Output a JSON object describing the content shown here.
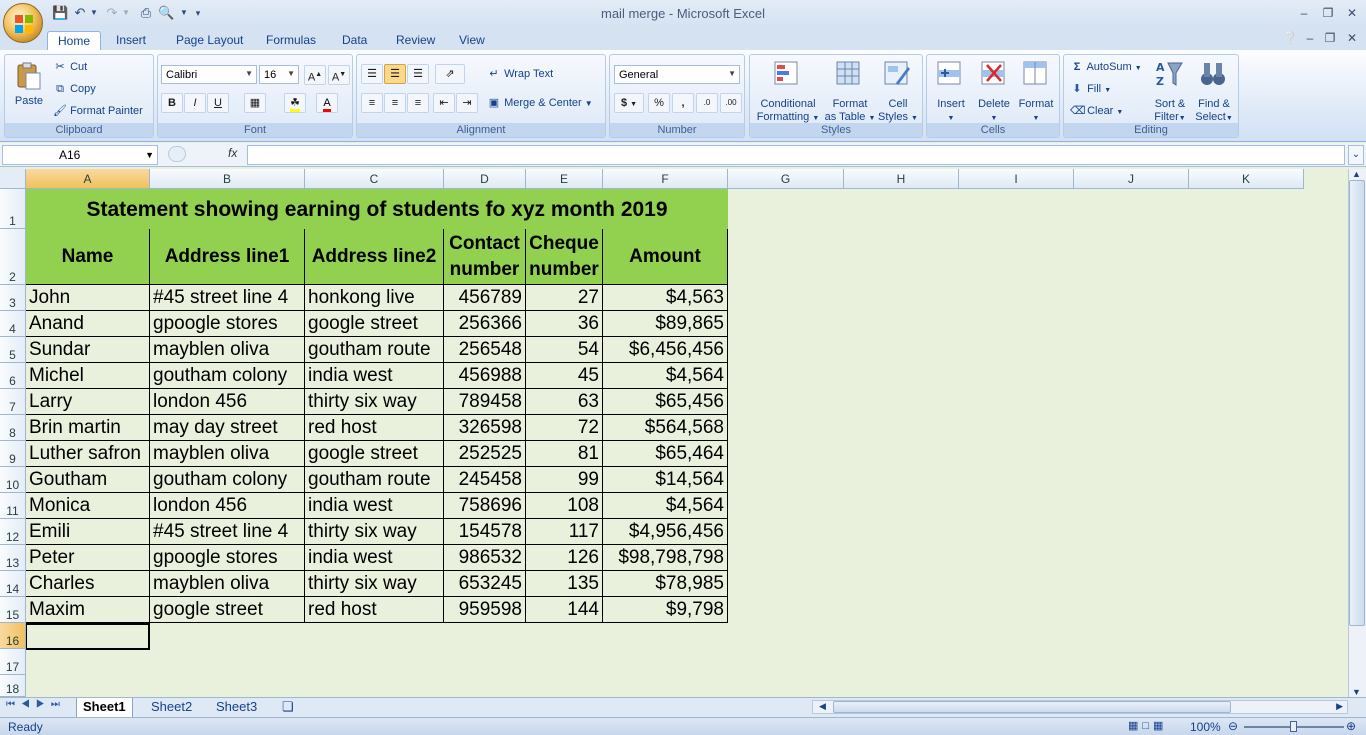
{
  "app": {
    "title": "mail merge - Microsoft Excel"
  },
  "tabs": [
    "Home",
    "Insert",
    "Page Layout",
    "Formulas",
    "Data",
    "Review",
    "View"
  ],
  "ribbon": {
    "clipboard": {
      "paste": "Paste",
      "cut": "Cut",
      "copy": "Copy",
      "format_painter": "Format Painter",
      "label": "Clipboard"
    },
    "font": {
      "name": "Calibri",
      "size": "16",
      "label": "Font"
    },
    "alignment": {
      "wrap": "Wrap Text",
      "merge": "Merge & Center",
      "label": "Alignment"
    },
    "number": {
      "format": "General",
      "label": "Number"
    },
    "styles": {
      "conditional_1": "Conditional",
      "conditional_2": "Formatting",
      "format_table_1": "Format",
      "format_table_2": "as Table",
      "cell_styles_1": "Cell",
      "cell_styles_2": "Styles",
      "label": "Styles"
    },
    "cells": {
      "insert": "Insert",
      "delete": "Delete",
      "format": "Format",
      "label": "Cells"
    },
    "editing": {
      "autosum": "AutoSum",
      "fill": "Fill",
      "clear": "Clear",
      "sort_1": "Sort &",
      "sort_2": "Filter",
      "find_1": "Find &",
      "find_2": "Select",
      "label": "Editing"
    }
  },
  "formula_bar": {
    "name_box": "A16",
    "fx": "fx",
    "value": ""
  },
  "columns": [
    "A",
    "B",
    "C",
    "D",
    "E",
    "F",
    "G",
    "H",
    "I",
    "J",
    "K"
  ],
  "rows": [
    "1",
    "2",
    "3",
    "4",
    "5",
    "6",
    "7",
    "8",
    "9",
    "10",
    "11",
    "12",
    "13",
    "14",
    "15",
    "16",
    "17",
    "18"
  ],
  "sheet": {
    "title": "Statement showing earning of students fo xyz month 2019",
    "headers": {
      "name": "Name",
      "addr1": "Address line1",
      "addr2": "Address line2",
      "contact_1": "Contact",
      "contact_2": "number",
      "cheque_1": "Cheque",
      "cheque_2": "number",
      "amount": "Amount"
    },
    "data": [
      [
        "John",
        "#45 street line 4",
        "honkong live",
        "456789",
        "27",
        "$4,563"
      ],
      [
        "Anand",
        "gpoogle stores",
        "google street",
        "256366",
        "36",
        "$89,865"
      ],
      [
        "Sundar",
        "mayblen oliva",
        "goutham route",
        "256548",
        "54",
        "$6,456,456"
      ],
      [
        "Michel",
        "goutham colony",
        "india west",
        "456988",
        "45",
        "$4,564"
      ],
      [
        "Larry",
        "london 456",
        "thirty six way",
        "789458",
        "63",
        "$65,456"
      ],
      [
        "Brin martin",
        "may day street",
        "red host",
        "326598",
        "72",
        "$564,568"
      ],
      [
        "Luther safron",
        "mayblen oliva",
        "google street",
        "252525",
        "81",
        "$65,464"
      ],
      [
        "Goutham",
        "goutham colony",
        "goutham route",
        "245458",
        "99",
        "$14,564"
      ],
      [
        "Monica",
        "london 456",
        "india west",
        "758696",
        "108",
        "$4,564"
      ],
      [
        "Emili",
        "#45 street line 4",
        "thirty six way",
        "154578",
        "117",
        "$4,956,456"
      ],
      [
        "Peter",
        "gpoogle stores",
        "india west",
        "986532",
        "126",
        "$98,798,798"
      ],
      [
        "Charles",
        "mayblen oliva",
        "thirty six way",
        "653245",
        "135",
        "$78,985"
      ],
      [
        "Maxim",
        "google street",
        "red host",
        "959598",
        "144",
        "$9,798"
      ]
    ]
  },
  "sheet_tabs": [
    "Sheet1",
    "Sheet2",
    "Sheet3"
  ],
  "status": {
    "ready": "Ready",
    "zoom": "100%"
  },
  "colors": {
    "header_green": "#92d050",
    "sheet_bg": "#e9f0dc",
    "ribbon_text": "#15428b"
  }
}
